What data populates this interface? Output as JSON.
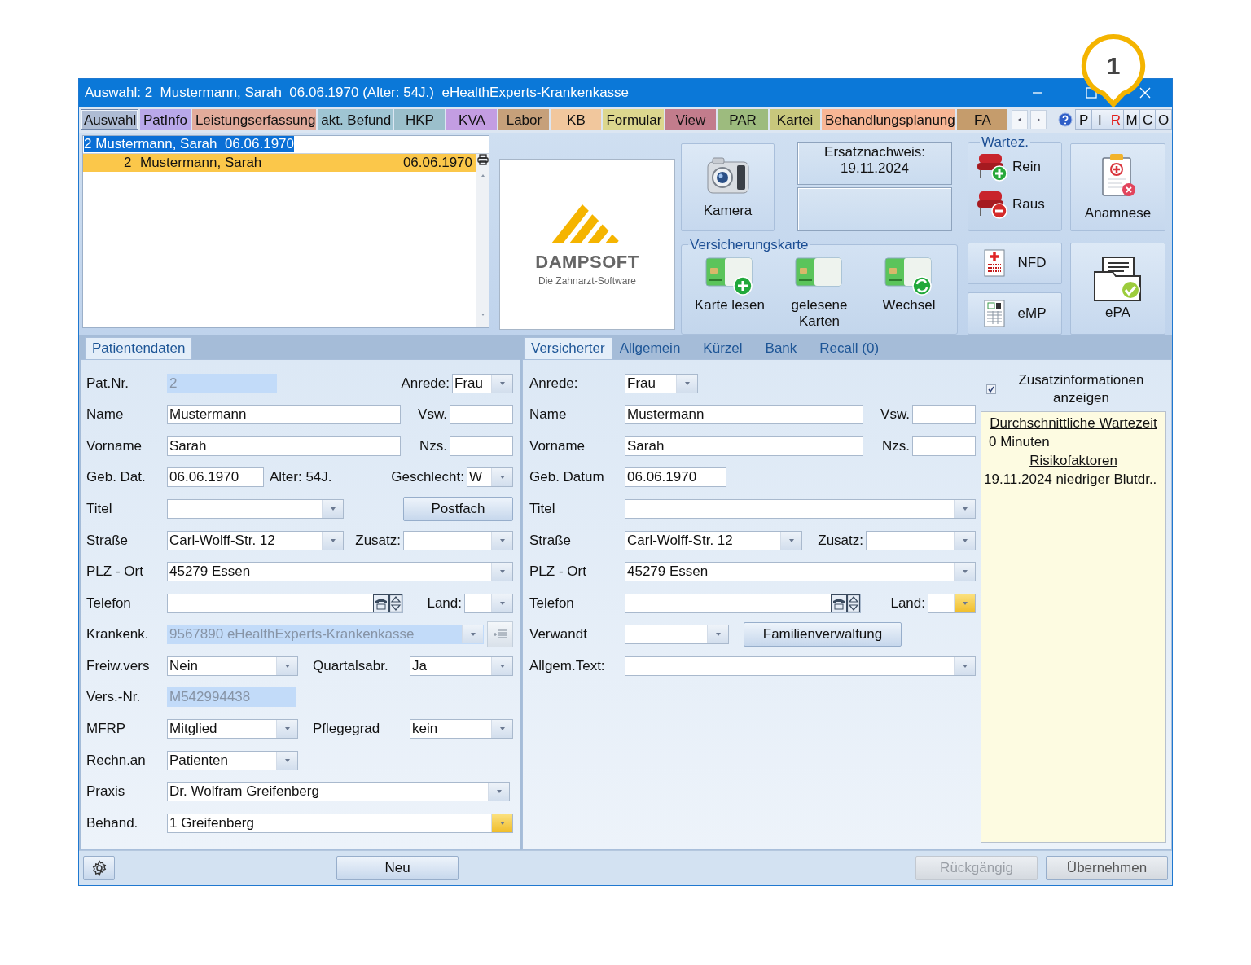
{
  "window": {
    "title": "Auswahl: 2  Mustermann, Sarah  06.06.1970 (Alter: 54J.)  eHealthExperts-Krankenkasse"
  },
  "callout": {
    "label": "1"
  },
  "module_tabs": [
    {
      "label": "Auswahl",
      "color": "#aebcd4",
      "selected": true
    },
    {
      "label": "PatInfo",
      "color": "#b9a8ea",
      "selected": false
    },
    {
      "label": "Leistungserfassung",
      "color": "#e2ab9b",
      "selected": false
    },
    {
      "label": "akt. Befund",
      "color": "#9fc5d3",
      "selected": false
    },
    {
      "label": "HKP",
      "color": "#9bbfcb",
      "selected": false
    },
    {
      "label": "KVA",
      "color": "#c39de2",
      "selected": false
    },
    {
      "label": "Labor",
      "color": "#c6a07a",
      "selected": false
    },
    {
      "label": "KB",
      "color": "#f1c79d",
      "selected": false
    },
    {
      "label": "Formular",
      "color": "#dcd78e",
      "selected": false
    },
    {
      "label": "View",
      "color": "#c27c8c",
      "selected": false
    },
    {
      "label": "PAR",
      "color": "#9dbb7e",
      "selected": false
    },
    {
      "label": "Kartei",
      "color": "#c8c77c",
      "selected": false
    },
    {
      "label": "Behandlungsplanung",
      "color": "#f8b695",
      "selected": false
    },
    {
      "label": "FA",
      "color": "#c59c6c",
      "selected": false
    }
  ],
  "mode_buttons": [
    {
      "label": "P",
      "selected": false
    },
    {
      "label": "I",
      "selected": false
    },
    {
      "label": "R",
      "selected": true
    },
    {
      "label": "M",
      "selected": false
    },
    {
      "label": "C",
      "selected": false
    },
    {
      "label": "O",
      "selected": false
    }
  ],
  "patient_search": {
    "value": "2 Mustermann, Sarah  06.06.1970"
  },
  "patient_list": [
    {
      "number": "2",
      "name": "Mustermann, Sarah",
      "birth_date": "06.06.1970",
      "selected": true
    }
  ],
  "logo": {
    "name": "DAMPSOFT",
    "tagline": "Die Zahnarzt-Software"
  },
  "camera_button": {
    "label": "Kamera"
  },
  "ersatznachweis": {
    "text": "Ersatznachweis:\n19.11.2024"
  },
  "waiting_room": {
    "title": "Wartez.",
    "buttons": [
      {
        "label": "Rein",
        "kind": "in"
      },
      {
        "label": "Raus",
        "kind": "out"
      }
    ]
  },
  "anamnese_button": {
    "label": "Anamnese"
  },
  "insurance_card": {
    "title": "Versicherungskarte",
    "buttons": [
      {
        "label": "Karte lesen",
        "kind": "read"
      },
      {
        "label": "gelesene Karten",
        "kind": "list"
      },
      {
        "label": "Wechsel",
        "kind": "switch"
      }
    ]
  },
  "nfd_button": {
    "label": "NFD"
  },
  "emp_button": {
    "label": "eMP"
  },
  "epa_button": {
    "label": "ePA"
  },
  "left_panel": {
    "tabs": [
      {
        "label": "Patientendaten",
        "selected": true
      }
    ],
    "rows": [
      {
        "items": [
          {
            "kind": "label",
            "text": "Pat.Nr."
          },
          {
            "kind": "readonly",
            "value": "2"
          },
          {
            "kind": "label",
            "text": "Anrede:"
          },
          {
            "kind": "combo",
            "value": "Frau"
          }
        ]
      },
      {
        "items": [
          {
            "kind": "label",
            "text": "Name"
          },
          {
            "kind": "text",
            "value": "Mustermann"
          },
          {
            "kind": "label",
            "text": "Vsw."
          },
          {
            "kind": "text"
          }
        ]
      },
      {
        "items": [
          {
            "kind": "label",
            "text": "Vorname"
          },
          {
            "kind": "text",
            "value": "Sarah"
          },
          {
            "kind": "label",
            "text": "Nzs."
          },
          {
            "kind": "text"
          }
        ]
      },
      {
        "items": [
          {
            "kind": "label",
            "text": "Geb. Dat."
          },
          {
            "kind": "text",
            "value": "06.06.1970"
          },
          {
            "kind": "label",
            "text": "Alter: 54J."
          },
          {
            "kind": "label",
            "text": "Geschlecht:"
          },
          {
            "kind": "combo",
            "value": "W"
          }
        ]
      },
      {
        "items": [
          {
            "kind": "label",
            "text": "Titel"
          },
          {
            "kind": "combo"
          },
          {
            "kind": "button",
            "label": "Postfach"
          }
        ]
      },
      {
        "items": [
          {
            "kind": "label",
            "text": "Straße"
          },
          {
            "kind": "combo",
            "value": "Carl-Wolff-Str. 12"
          },
          {
            "kind": "label",
            "text": "Zusatz:"
          },
          {
            "kind": "combo"
          }
        ]
      },
      {
        "items": [
          {
            "kind": "label",
            "text": "PLZ - Ort"
          },
          {
            "kind": "combo",
            "value": "45279 Essen"
          }
        ]
      },
      {
        "items": [
          {
            "kind": "label",
            "text": "Telefon"
          },
          {
            "kind": "phone"
          },
          {
            "kind": "label",
            "text": "Land:"
          },
          {
            "kind": "combo"
          }
        ]
      },
      {
        "items": [
          {
            "kind": "label",
            "text": "Krankenk."
          },
          {
            "kind": "readonly-combo",
            "value": "9567890 eHealthExperts-Krankenkasse"
          },
          {
            "kind": "list-button"
          }
        ]
      },
      {
        "items": [
          {
            "kind": "label",
            "text": "Freiw.vers"
          },
          {
            "kind": "combo",
            "value": "Nein"
          },
          {
            "kind": "label",
            "text": "Quartalsabr."
          },
          {
            "kind": "combo",
            "value": "Ja"
          }
        ]
      },
      {
        "items": [
          {
            "kind": "label",
            "text": "Vers.-Nr."
          },
          {
            "kind": "readonly",
            "value": "M542994438"
          }
        ]
      },
      {
        "items": [
          {
            "kind": "label",
            "text": "MFRP"
          },
          {
            "kind": "combo",
            "value": "Mitglied"
          },
          {
            "kind": "label",
            "text": "Pflegegrad"
          },
          {
            "kind": "combo",
            "value": "kein"
          }
        ]
      },
      {
        "items": [
          {
            "kind": "label",
            "text": "Rechn.an"
          },
          {
            "kind": "combo",
            "value": "Patienten"
          }
        ]
      },
      {
        "items": [
          {
            "kind": "label",
            "text": "Praxis"
          },
          {
            "kind": "combo",
            "value": "Dr. Wolfram Greifenberg"
          }
        ]
      },
      {
        "items": [
          {
            "kind": "label",
            "text": "Behand."
          },
          {
            "kind": "combo",
            "value": "1 Greifenberg",
            "accent": true
          }
        ]
      }
    ]
  },
  "right_panel": {
    "tabs": [
      {
        "label": "Versicherter",
        "selected": true
      },
      {
        "label": "Allgemein",
        "selected": false
      },
      {
        "label": "Kürzel",
        "selected": false
      },
      {
        "label": "Bank",
        "selected": false
      },
      {
        "label": "Recall (0)",
        "selected": false
      }
    ],
    "rows": [
      {
        "items": [
          {
            "kind": "label",
            "text": "Anrede:"
          },
          {
            "kind": "combo",
            "value": "Frau"
          }
        ]
      },
      {
        "items": [
          {
            "kind": "label",
            "text": "Name"
          },
          {
            "kind": "text",
            "value": "Mustermann"
          },
          {
            "kind": "label",
            "text": "Vsw."
          },
          {
            "kind": "text"
          }
        ]
      },
      {
        "items": [
          {
            "kind": "label",
            "text": "Vorname"
          },
          {
            "kind": "text",
            "value": "Sarah"
          },
          {
            "kind": "label",
            "text": "Nzs."
          },
          {
            "kind": "text"
          }
        ]
      },
      {
        "items": [
          {
            "kind": "label",
            "text": "Geb. Datum"
          },
          {
            "kind": "text",
            "value": "06.06.1970"
          }
        ]
      },
      {
        "items": [
          {
            "kind": "label",
            "text": "Titel"
          },
          {
            "kind": "combo"
          }
        ]
      },
      {
        "items": [
          {
            "kind": "label",
            "text": "Straße"
          },
          {
            "kind": "combo",
            "value": "Carl-Wolff-Str. 12"
          },
          {
            "kind": "label",
            "text": "Zusatz:"
          },
          {
            "kind": "combo"
          }
        ]
      },
      {
        "items": [
          {
            "kind": "label",
            "text": "PLZ - Ort"
          },
          {
            "kind": "combo",
            "value": "45279 Essen"
          }
        ]
      },
      {
        "items": [
          {
            "kind": "label",
            "text": "Telefon"
          },
          {
            "kind": "phone"
          },
          {
            "kind": "label",
            "text": "Land:"
          },
          {
            "kind": "combo",
            "accent": true
          }
        ]
      },
      {
        "items": [
          {
            "kind": "label",
            "text": "Verwandt"
          },
          {
            "kind": "combo"
          },
          {
            "kind": "button",
            "label": "Familienverwaltung"
          }
        ]
      },
      {
        "items": [
          {
            "kind": "label",
            "text": "Allgem.Text:"
          },
          {
            "kind": "combo"
          }
        ]
      }
    ]
  },
  "extra_info": {
    "label": "Zusatzinformationen anzeigen",
    "checked": true,
    "lines": [
      {
        "kind": "heading",
        "text": "Durchschnittliche Wartezeit"
      },
      {
        "kind": "text",
        "text": "0 Minuten"
      },
      {
        "kind": "heading",
        "text": "Risikofaktoren"
      },
      {
        "kind": "text",
        "text": "19.11.2024 niedriger Blutdr.."
      }
    ]
  },
  "bottom_bar": {
    "buttons": [
      {
        "label": "Neu",
        "disabled": false
      },
      {
        "label": "Rückgängig",
        "disabled": true
      },
      {
        "label": "Übernehmen",
        "disabled": false
      }
    ]
  }
}
